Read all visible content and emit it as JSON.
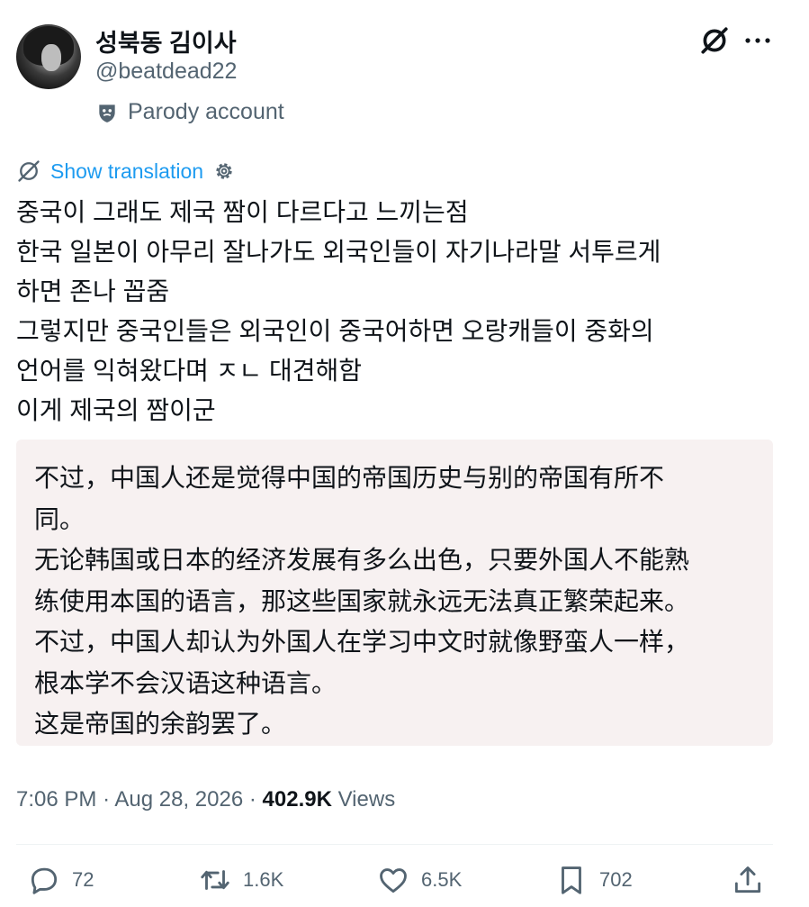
{
  "author": {
    "display_name": "성북동 김이사",
    "handle": "@beatdead22",
    "badge_label": "Parody account"
  },
  "icons": {
    "header": [
      "grok-icon",
      "more-icon"
    ],
    "badge": "theater-mask-icon",
    "translate": [
      "grok-icon",
      "gear-icon"
    ],
    "actions": [
      "reply-icon",
      "retweet-icon",
      "like-icon",
      "bookmark-icon",
      "share-icon"
    ]
  },
  "translate": {
    "label": "Show translation"
  },
  "tweet": {
    "lines": [
      "중국이 그래도 제국 짬이 다르다고 느끼는점",
      "한국 일본이 아무리 잘나가도 외국인들이 자기나라말 서투르게",
      "하면 존나 꼽줌",
      "그렇지만 중국인들은 외국인이 중국어하면 오랑캐들이 중화의",
      "언어를 익혀왔다며 ㅈㄴ 대견해함",
      "이게 제국의 짬이군"
    ]
  },
  "translation": {
    "lines": [
      "不过，中国人还是觉得中国的帝国历史与别的帝国有所不",
      "同。",
      "无论韩国或日本的经济发展有多么出色，只要外国人不能熟",
      "练使用本国的语言，那这些国家就永远无法真正繁荣起来。",
      "不过，中国人却认为外国人在学习中文时就像野蛮人一样，",
      "根本学不会汉语这种语言。",
      "这是帝国的余韵罢了。"
    ]
  },
  "meta": {
    "time": "7:06 PM",
    "separator": "·",
    "date": "Aug 28, 2026",
    "views_count": "402.9K",
    "views_label": "Views"
  },
  "actions": {
    "replies": "72",
    "reposts": "1.6K",
    "likes": "6.5K",
    "bookmarks": "702"
  },
  "colors": {
    "text": "#0f1419",
    "secondary": "#536471",
    "link": "#1d9bf0",
    "translation_bg": "#f7f1f1"
  }
}
